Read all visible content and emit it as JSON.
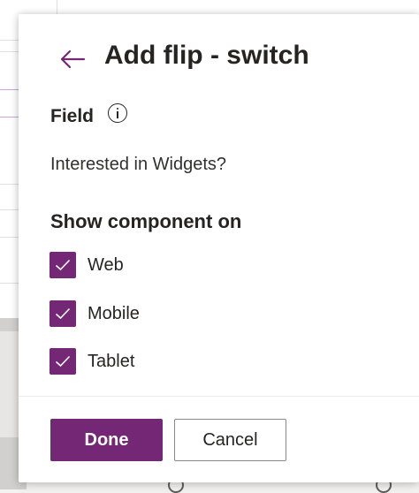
{
  "panel": {
    "title": "Add flip - switch",
    "back_icon": "arrow-left-icon",
    "field_label": "Field",
    "field_info_icon": "info-icon",
    "field_value": "Interested in Widgets?",
    "section_title": "Show component on",
    "options": [
      {
        "label": "Web",
        "checked": true
      },
      {
        "label": "Mobile",
        "checked": true
      },
      {
        "label": "Tablet",
        "checked": true
      }
    ],
    "done_label": "Done",
    "cancel_label": "Cancel"
  },
  "colors": {
    "accent": "#742774",
    "text": "#252423",
    "border": "#8a8886"
  }
}
